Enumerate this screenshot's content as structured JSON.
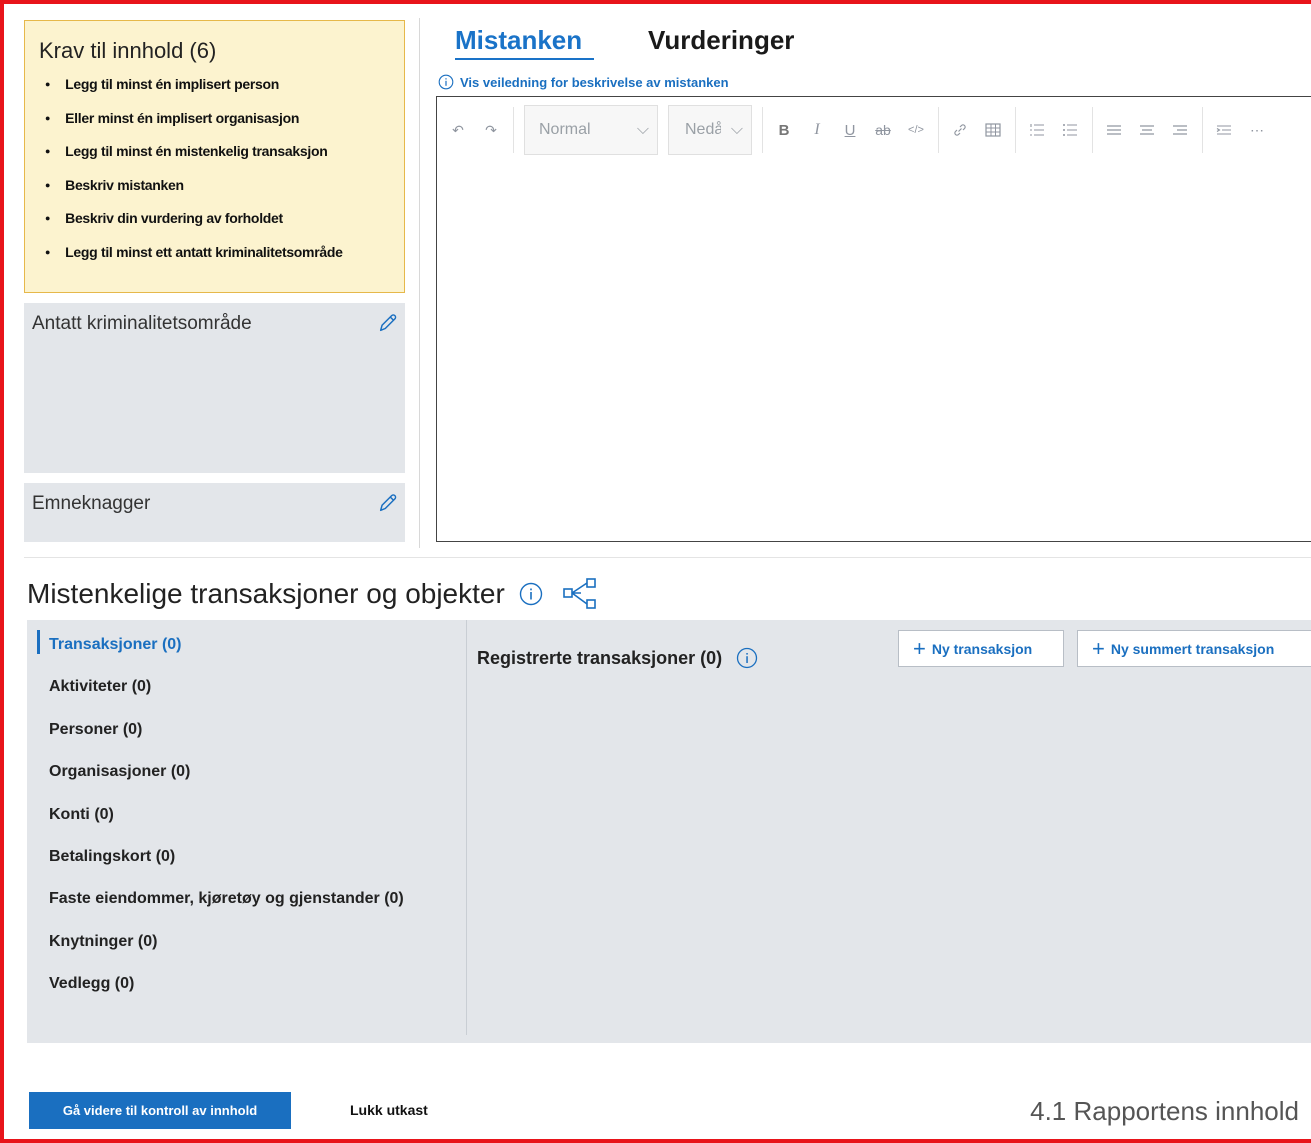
{
  "requirements": {
    "title": "Krav til innhold (6)",
    "items": [
      "Legg til minst én implisert person",
      "Eller minst én implisert organisasjon",
      "Legg til minst én mistenkelig transaksjon",
      "Beskriv mistanken",
      "Beskriv din vurdering av forholdet",
      "Legg til minst ett antatt kriminalitetsområde"
    ]
  },
  "panels": {
    "crime_area": "Antatt kriminalitetsområde",
    "hashtags": "Emneknagger"
  },
  "tabs": {
    "active": "Mistanken",
    "inactive": "Vurderinger"
  },
  "guide_link": "Vis veiledning for beskrivelse av mistanken",
  "editor": {
    "format_select": "Normal",
    "level_select": "Nedå"
  },
  "section": {
    "title": "Mistenkelige transaksjoner og objekter"
  },
  "objects_nav": [
    "Transaksjoner (0)",
    "Aktiviteter (0)",
    "Personer (0)",
    "Organisasjoner (0)",
    "Konti (0)",
    "Betalingskort (0)",
    "Faste eiendommer, kjøretøy og gjenstander (0)",
    "Knytninger (0)",
    "Vedlegg (0)"
  ],
  "registered": {
    "title": "Registrerte transaksjoner (0)",
    "new_button": "Ny transaksjon",
    "new_summed_button": "Ny summert transaksjon"
  },
  "footer": {
    "continue_button": "Gå videre til kontroll av innhold",
    "close_button": "Lukk utkast",
    "caption": "4.1 Rapportens innhold"
  },
  "colors": {
    "accent": "#1a6fc0",
    "frame": "#e8141a",
    "requirements_bg": "#fcf3cf",
    "panel_bg": "#e3e6ea"
  }
}
